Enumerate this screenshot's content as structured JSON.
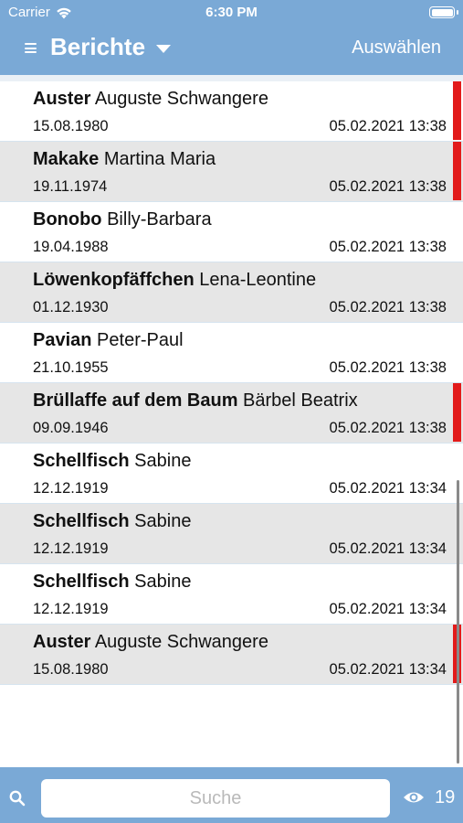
{
  "status_bar": {
    "carrier": "Carrier",
    "time": "6:30 PM"
  },
  "nav": {
    "title": "Berichte",
    "select_label": "Auswählen"
  },
  "reports": [
    {
      "name_bold": "Auster",
      "name_rest": "Auguste Schwangere",
      "birth": "15.08.1980",
      "stamp": "05.02.2021 13:38",
      "flagged": true
    },
    {
      "name_bold": "Makake",
      "name_rest": "Martina Maria",
      "birth": "19.11.1974",
      "stamp": "05.02.2021 13:38",
      "flagged": true
    },
    {
      "name_bold": "Bonobo",
      "name_rest": "Billy-Barbara",
      "birth": "19.04.1988",
      "stamp": "05.02.2021 13:38",
      "flagged": false
    },
    {
      "name_bold": "Löwenkopfäffchen",
      "name_rest": "Lena-Leontine",
      "birth": "01.12.1930",
      "stamp": "05.02.2021 13:38",
      "flagged": false
    },
    {
      "name_bold": "Pavian",
      "name_rest": "Peter-Paul",
      "birth": "21.10.1955",
      "stamp": "05.02.2021 13:38",
      "flagged": false
    },
    {
      "name_bold": "Brüllaffe auf dem Baum",
      "name_rest": "Bärbel Beatrix",
      "birth": "09.09.1946",
      "stamp": "05.02.2021 13:38",
      "flagged": true
    },
    {
      "name_bold": "Schellfisch",
      "name_rest": "Sabine",
      "birth": "12.12.1919",
      "stamp": "05.02.2021 13:34",
      "flagged": false
    },
    {
      "name_bold": "Schellfisch",
      "name_rest": "Sabine",
      "birth": "12.12.1919",
      "stamp": "05.02.2021 13:34",
      "flagged": false
    },
    {
      "name_bold": "Schellfisch",
      "name_rest": "Sabine",
      "birth": "12.12.1919",
      "stamp": "05.02.2021 13:34",
      "flagged": false
    },
    {
      "name_bold": "Auster",
      "name_rest": "Auguste Schwangere",
      "birth": "15.08.1980",
      "stamp": "05.02.2021 13:34",
      "flagged": true
    }
  ],
  "search": {
    "placeholder": "Suche",
    "value": ""
  },
  "visible_count": "19",
  "colors": {
    "bar": "#7aa9d6",
    "flag": "#e21b1b",
    "alt_row": "#e6e6e6"
  }
}
